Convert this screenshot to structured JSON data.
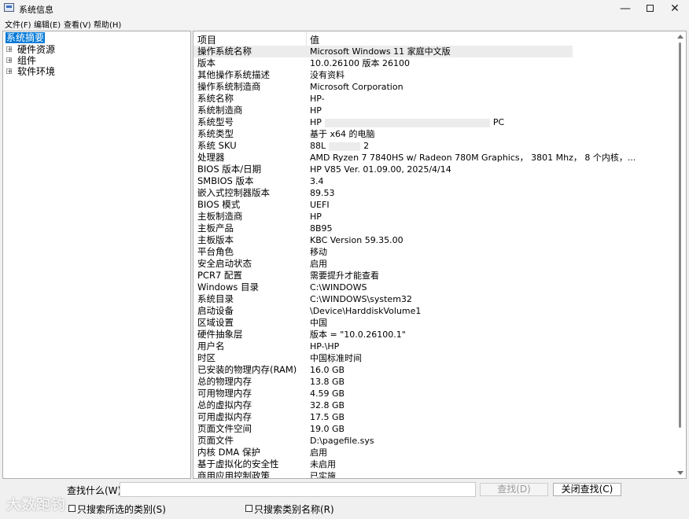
{
  "window": {
    "title": "系统信息"
  },
  "window_controls": {
    "minimize": "—",
    "close": "✕"
  },
  "menu": [
    "文件(F)",
    "编辑(E)",
    "查看(V)",
    "帮助(H)"
  ],
  "tree": [
    {
      "label": "系统摘要",
      "selected": true,
      "expandable": false
    },
    {
      "label": "硬件资源",
      "selected": false,
      "expandable": true
    },
    {
      "label": "组件",
      "selected": false,
      "expandable": true
    },
    {
      "label": "软件环境",
      "selected": false,
      "expandable": true
    }
  ],
  "list": {
    "headers": {
      "item": "项目",
      "value": "值"
    },
    "rows": [
      {
        "item": "操作系统名称",
        "value": "Microsoft Windows 11 家庭中文版",
        "selected": true
      },
      {
        "item": "版本",
        "value": "10.0.26100 版本 26100"
      },
      {
        "item": "其他操作系统描述",
        "value": "没有资料"
      },
      {
        "item": "操作系统制造商",
        "value": "Microsoft Corporation"
      },
      {
        "item": "系统名称",
        "value": "HP-"
      },
      {
        "item": "系统制造商",
        "value": "HP"
      },
      {
        "item": "系统型号",
        "value": "HP",
        "value_suffix": "PC"
      },
      {
        "item": "系统类型",
        "value": "基于 x64 的电脑"
      },
      {
        "item": "系统 SKU",
        "value": "88L",
        "value_suffix": "2"
      },
      {
        "item": "处理器",
        "value": "AMD Ryzen 7 7840HS w/ Radeon 780M Graphics， 3801 Mhz， 8 个内核，..."
      },
      {
        "item": "BIOS 版本/日期",
        "value": "HP V85 Ver. 01.09.00, 2025/4/14"
      },
      {
        "item": "SMBIOS 版本",
        "value": "3.4"
      },
      {
        "item": "嵌入式控制器版本",
        "value": "89.53"
      },
      {
        "item": "BIOS 模式",
        "value": "UEFI"
      },
      {
        "item": "主板制造商",
        "value": "HP"
      },
      {
        "item": "主板产品",
        "value": "8B95"
      },
      {
        "item": "主板版本",
        "value": "KBC Version 59.35.00"
      },
      {
        "item": "平台角色",
        "value": "移动"
      },
      {
        "item": "安全启动状态",
        "value": "启用"
      },
      {
        "item": "PCR7 配置",
        "value": "需要提升才能查看"
      },
      {
        "item": "Windows 目录",
        "value": "C:\\WINDOWS"
      },
      {
        "item": "系统目录",
        "value": "C:\\WINDOWS\\system32"
      },
      {
        "item": "启动设备",
        "value": "\\Device\\HarddiskVolume1"
      },
      {
        "item": "区域设置",
        "value": "中国"
      },
      {
        "item": "硬件抽象层",
        "value": "版本 = \"10.0.26100.1\""
      },
      {
        "item": "用户名",
        "value": "HP-\\HP"
      },
      {
        "item": "时区",
        "value": "中国标准时间"
      },
      {
        "item": "已安装的物理内存(RAM)",
        "value": "16.0 GB"
      },
      {
        "item": "总的物理内存",
        "value": "13.8 GB"
      },
      {
        "item": "可用物理内存",
        "value": "4.59 GB"
      },
      {
        "item": "总的虚拟内存",
        "value": "32.8 GB"
      },
      {
        "item": "可用虚拟内存",
        "value": "17.5 GB"
      },
      {
        "item": "页面文件空间",
        "value": "19.0 GB"
      },
      {
        "item": "页面文件",
        "value": "D:\\pagefile.sys"
      },
      {
        "item": "内核 DMA 保护",
        "value": "启用"
      },
      {
        "item": "基于虚拟化的安全性",
        "value": "未启用"
      },
      {
        "item": "商用应用控制政策",
        "value": "已实施"
      }
    ]
  },
  "search": {
    "label": "查找什么(W):",
    "value": "",
    "find_button": "查找(D)",
    "close_find_button": "关闭查找(C)",
    "only_selected_category": "只搜索所选的类别(S)",
    "only_category_names": "只搜索类别名称(R)"
  },
  "watermark": "大数跑钓"
}
